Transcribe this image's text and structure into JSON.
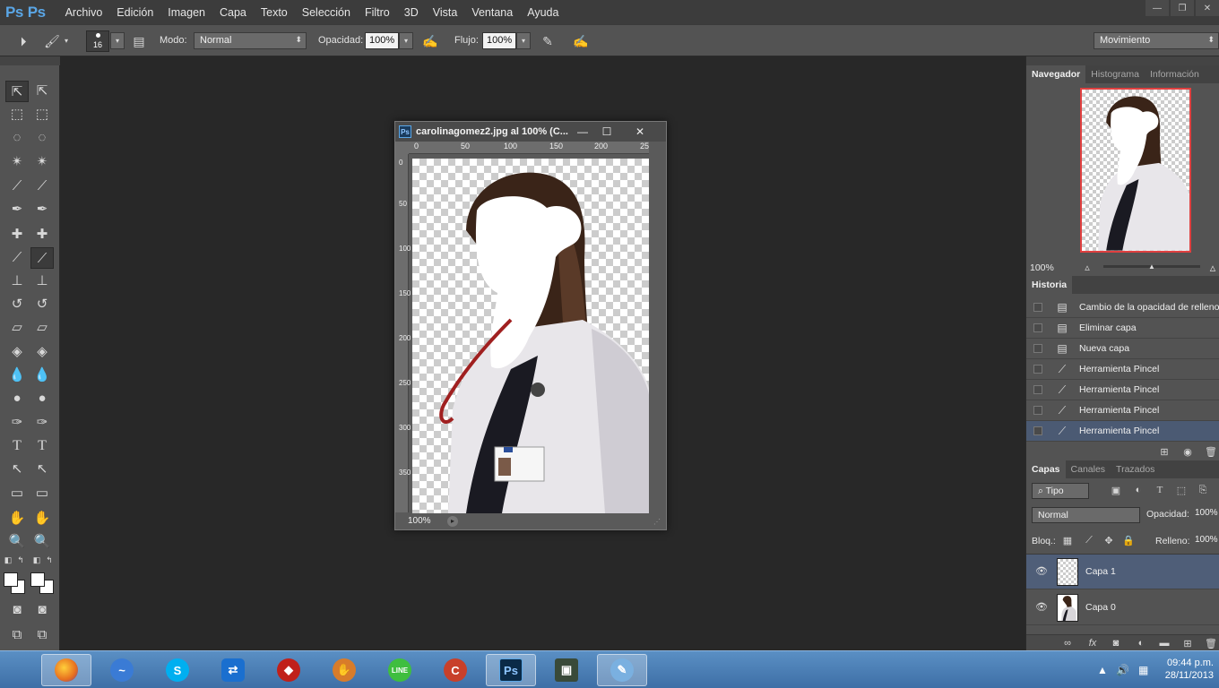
{
  "app": {
    "logos": [
      "Ps",
      "Ps"
    ],
    "menu": [
      "Archivo",
      "Edición",
      "Imagen",
      "Capa",
      "Texto",
      "Selección",
      "Filtro",
      "3D",
      "Vista",
      "Ventana",
      "Ayuda"
    ],
    "window_controls": [
      "—",
      "❐",
      "✕"
    ]
  },
  "options_bar": {
    "brush_size": "16",
    "mode_label": "Modo:",
    "mode_value": "Normal",
    "opacity_label": "Opacidad:",
    "opacity_value": "100%",
    "flow_label": "Flujo:",
    "flow_value": "100%",
    "workspace_value": "Movimiento"
  },
  "document": {
    "title": "carolinagomez2.jpg al 100% (C...",
    "zoom": "100%",
    "ruler_h": [
      "0",
      "50",
      "100",
      "150",
      "200",
      "25"
    ],
    "ruler_v": [
      "0",
      "50",
      "100",
      "150",
      "200",
      "250",
      "300",
      "350"
    ]
  },
  "navigator": {
    "tabs": [
      "Navegador",
      "Histograma",
      "Información"
    ],
    "zoom": "100%"
  },
  "history": {
    "tab": "Historia",
    "items": [
      {
        "label": "Cambio de la opacidad de relleno",
        "icon": "document-icon"
      },
      {
        "label": "Eliminar capa",
        "icon": "document-icon"
      },
      {
        "label": "Nueva capa",
        "icon": "document-icon"
      },
      {
        "label": "Herramienta Pincel",
        "icon": "brush-icon"
      },
      {
        "label": "Herramienta Pincel",
        "icon": "brush-icon"
      },
      {
        "label": "Herramienta Pincel",
        "icon": "brush-icon"
      },
      {
        "label": "Herramienta Pincel",
        "icon": "brush-icon"
      }
    ]
  },
  "layers": {
    "tabs": [
      "Capas",
      "Canales",
      "Trazados"
    ],
    "filter_label": "Tipo",
    "blend_mode": "Normal",
    "opacity_label": "Opacidad:",
    "opacity_value": "100%",
    "lock_label": "Bloq.:",
    "fill_label": "Relleno:",
    "fill_value": "100%",
    "items": [
      {
        "name": "Capa 1"
      },
      {
        "name": "Capa 0"
      }
    ]
  },
  "taskbar": {
    "time": "09:44 p.m.",
    "date": "28/11/2013",
    "apps": [
      {
        "name": "firefox",
        "color": "#e76f1f",
        "glyph": ""
      },
      {
        "name": "messenger",
        "color": "#3a7bd5",
        "glyph": "~"
      },
      {
        "name": "skype",
        "color": "#00aff0",
        "glyph": "S"
      },
      {
        "name": "teamviewer",
        "color": "#1a6fcf",
        "glyph": "⇄"
      },
      {
        "name": "app-red",
        "color": "#c0201a",
        "glyph": "◆"
      },
      {
        "name": "app-glove",
        "color": "#d87c2a",
        "glyph": "✋"
      },
      {
        "name": "line",
        "color": "#3fbe3f",
        "glyph": "LINE"
      },
      {
        "name": "ccleaner",
        "color": "#c8402a",
        "glyph": "C"
      },
      {
        "name": "photoshop",
        "color": "#0b2a47",
        "glyph": "Ps"
      },
      {
        "name": "terminal",
        "color": "#394a39",
        "glyph": "▣"
      },
      {
        "name": "paint",
        "color": "#7ab0e0",
        "glyph": "🎨"
      }
    ]
  }
}
